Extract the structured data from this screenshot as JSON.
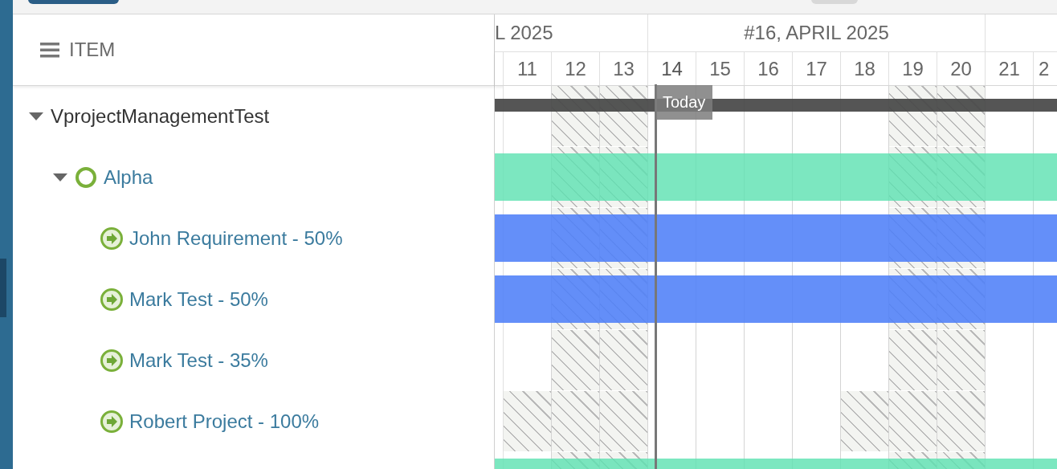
{
  "grid_header": {
    "title": "ITEM"
  },
  "weeks": [
    {
      "label": "L 2025",
      "days": [
        {
          "label": "11",
          "today": false
        },
        {
          "label": "12",
          "today": false
        },
        {
          "label": "13",
          "today": false
        }
      ]
    },
    {
      "label": "#16, APRIL 2025",
      "days": [
        {
          "label": "14",
          "today": true
        },
        {
          "label": "15",
          "today": false
        },
        {
          "label": "16",
          "today": false
        },
        {
          "label": "17",
          "today": false
        },
        {
          "label": "18",
          "today": false
        },
        {
          "label": "19",
          "today": false
        },
        {
          "label": "20",
          "today": false
        }
      ]
    },
    {
      "days": [
        {
          "label": "21",
          "today": false
        },
        {
          "label": "2",
          "today": false
        }
      ]
    }
  ],
  "today_marker": {
    "label": "Today"
  },
  "tree": [
    {
      "label": "VprojectManagementTest",
      "kind": "project",
      "expanded": true,
      "bar": {
        "kind": "summary"
      },
      "hatched": [
        false,
        true,
        true,
        false,
        false,
        false,
        false,
        false,
        true,
        true,
        false,
        false
      ],
      "children": [
        {
          "label": "Alpha",
          "kind": "phase",
          "expanded": true,
          "bar": {
            "kind": "phase"
          },
          "hatched": [
            false,
            true,
            true,
            false,
            false,
            false,
            false,
            false,
            true,
            true,
            false,
            false
          ],
          "children": [
            {
              "label": "John Requirement - 50%",
              "kind": "assignment",
              "bar": {
                "kind": "task"
              },
              "hatched": [
                false,
                true,
                true,
                false,
                false,
                false,
                false,
                false,
                true,
                true,
                false,
                false
              ]
            },
            {
              "label": "Mark Test - 50%",
              "kind": "assignment",
              "bar": {
                "kind": "task"
              },
              "hatched": [
                false,
                true,
                true,
                false,
                false,
                false,
                false,
                false,
                true,
                true,
                false,
                false
              ]
            },
            {
              "label": "Mark Test - 35%",
              "kind": "assignment",
              "hatched": [
                false,
                true,
                true,
                false,
                false,
                false,
                false,
                false,
                true,
                true,
                false,
                false
              ]
            },
            {
              "label": "Robert Project - 100%",
              "kind": "assignment",
              "hatched": [
                true,
                true,
                true,
                false,
                false,
                false,
                false,
                true,
                true,
                true,
                false,
                false
              ]
            }
          ]
        }
      ]
    }
  ],
  "partial_rows": [
    {
      "bar": {
        "kind": "phase"
      },
      "hatched": [
        false,
        true,
        true,
        false,
        false,
        false,
        false,
        false,
        true,
        true,
        false,
        false
      ]
    }
  ]
}
